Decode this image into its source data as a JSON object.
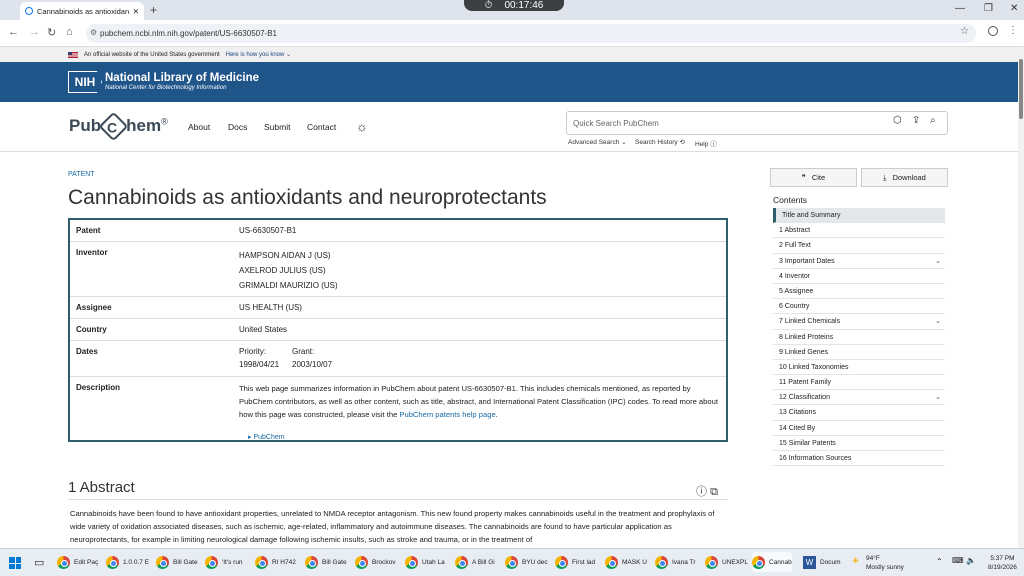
{
  "browser": {
    "tab_title": "Cannabinoids as antioxidants a",
    "timer": "00:17:46",
    "url": "pubchem.ncbi.nlm.nih.gov/patent/US-6630507-B1"
  },
  "gov_banner": {
    "text": "An official website of the United States government",
    "link": "Here is how you know"
  },
  "nlm": {
    "badge": "NIH",
    "title": "National Library of Medicine",
    "subtitle": "National Center for Biotechnology Information"
  },
  "pubchem": {
    "logo_left": "Pub",
    "logo_c": "C",
    "logo_right": "hem",
    "logo_mark": "®",
    "nav": [
      "About",
      "Docs",
      "Submit",
      "Contact"
    ],
    "search_placeholder": "Quick Search PubChem",
    "advanced_search": "Advanced Search",
    "search_history": "Search History",
    "help": "Help"
  },
  "page": {
    "kind": "PATENT",
    "title": "Cannabinoids as antioxidants and neuroprotectants"
  },
  "summary": {
    "patent_label": "Patent",
    "patent_value": "US-6630507-B1",
    "inventor_label": "Inventor",
    "inventors": [
      "HAMPSON AIDAN J (US)",
      "AXELROD JULIUS (US)",
      "GRIMALDI MAURIZIO (US)"
    ],
    "assignee_label": "Assignee",
    "assignee_value": "US HEALTH (US)",
    "country_label": "Country",
    "country_value": "United States",
    "dates_label": "Dates",
    "priority_label": "Priority:",
    "priority_value": "1998/04/21",
    "grant_label": "Grant:",
    "grant_value": "2003/10/07",
    "description_label": "Description",
    "description_text": "This web page summarizes information in PubChem about patent US-6630507-B1. This includes chemicals mentioned, as reported by PubChem contributors, as well as other content, such as title, abstract, and International Patent Classification (IPC) codes. To read more about how this page was constructed, please visit the ",
    "description_link": "PubChem patents help page",
    "description_end": ".",
    "pubchem_link": "PubChem"
  },
  "abstract": {
    "heading": "1 Abstract",
    "text": "Cannabinoids have been found to have antioxidant properties, unrelated to NMDA receptor antagonism. This new found property makes cannabinoids useful in the treatment and prophylaxis of wide variety of oxidation associated diseases, such as ischemic, age-related, inflammatory and autoimmune diseases. The cannabinoids are found to have particular application as neuroprotectants, for example in limiting neurological damage following ischemic insults, such as stroke and trauma, or in the treatment of"
  },
  "sidebar": {
    "cite": "Cite",
    "download": "Download",
    "contents_heading": "Contents",
    "toc": [
      {
        "label": "Title and Summary",
        "selected": true,
        "expand": false
      },
      {
        "label": "1 Abstract",
        "expand": false
      },
      {
        "label": "2 Full Text",
        "expand": false
      },
      {
        "label": "3 Important Dates",
        "expand": true
      },
      {
        "label": "4 Inventor",
        "expand": false
      },
      {
        "label": "5 Assignee",
        "expand": false
      },
      {
        "label": "6 Country",
        "expand": false
      },
      {
        "label": "7 Linked Chemicals",
        "expand": true
      },
      {
        "label": "8 Linked Proteins",
        "expand": false
      },
      {
        "label": "9 Linked Genes",
        "expand": false
      },
      {
        "label": "10 Linked Taxonomies",
        "expand": false
      },
      {
        "label": "11 Patent Family",
        "expand": false
      },
      {
        "label": "12 Classification",
        "expand": true
      },
      {
        "label": "13 Citations",
        "expand": false
      },
      {
        "label": "14 Cited By",
        "expand": false
      },
      {
        "label": "15 Similar Patents",
        "expand": false
      },
      {
        "label": "16 Information Sources",
        "expand": false
      }
    ]
  },
  "taskbar": {
    "apps": [
      "Edit Paç",
      "1.0.0.7 E",
      "Bill Gate",
      "'It's run",
      "RI H742",
      "Bill Gate",
      "Brockov",
      "Utah La",
      "A Bill Gi",
      "BYU dec",
      "First lad",
      "MASK U",
      "Ivana Tr",
      "UNEXPL",
      "Cannab",
      "Docum"
    ],
    "weather_temp": "94°F",
    "weather_desc": "Mostly sunny",
    "time": "5:37 PM",
    "date": "8/19/2026"
  }
}
